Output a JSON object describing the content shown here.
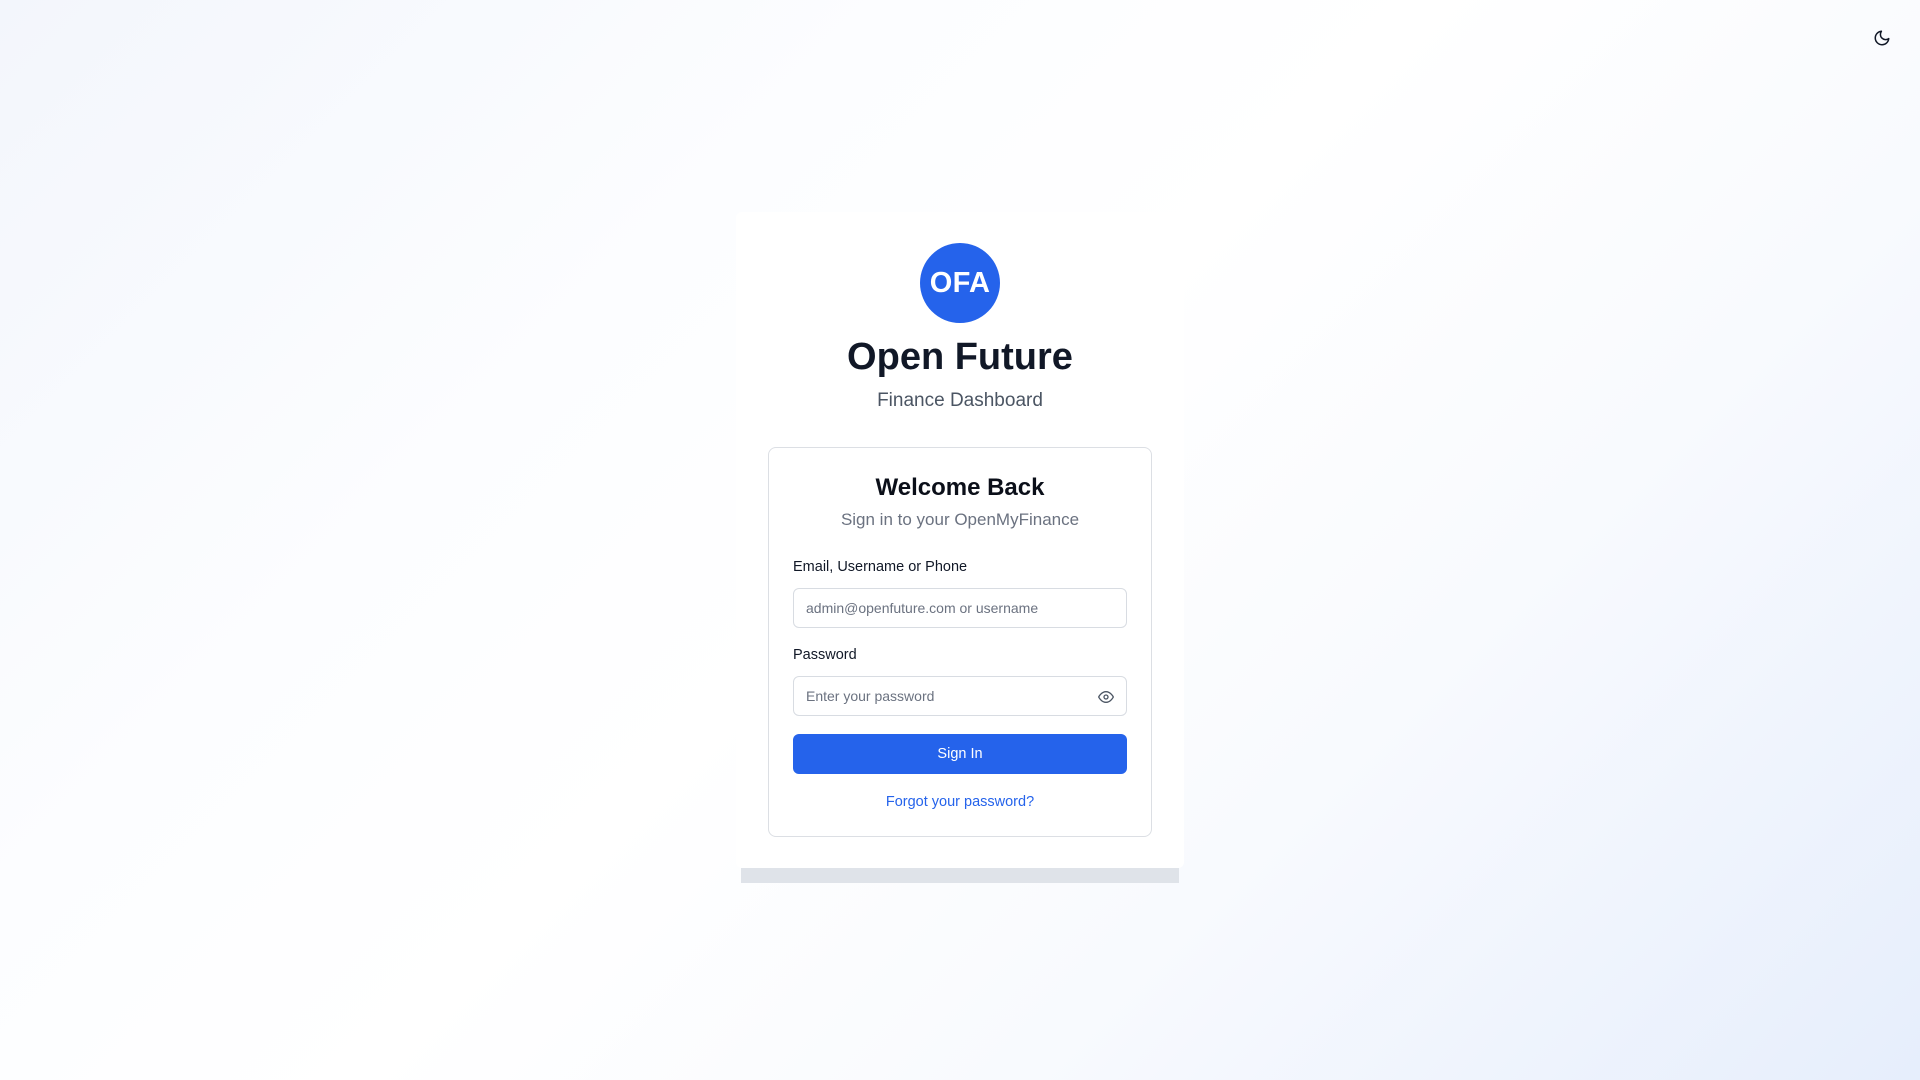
{
  "theme_toggle": {
    "icon": "moon-icon"
  },
  "brand": {
    "logo_text": "OFA",
    "title": "Open Future",
    "subtitle": "Finance Dashboard",
    "accent_color": "#2563eb"
  },
  "login": {
    "title": "Welcome Back",
    "subtitle": "Sign in to your OpenMyFinance",
    "identifier": {
      "label": "Email, Username or Phone",
      "placeholder": "admin@openfuture.com or username",
      "value": ""
    },
    "password": {
      "label": "Password",
      "placeholder": "Enter your password",
      "value": "",
      "toggle_icon": "eye-icon"
    },
    "submit_label": "Sign In",
    "forgot_label": "Forgot your password?"
  }
}
